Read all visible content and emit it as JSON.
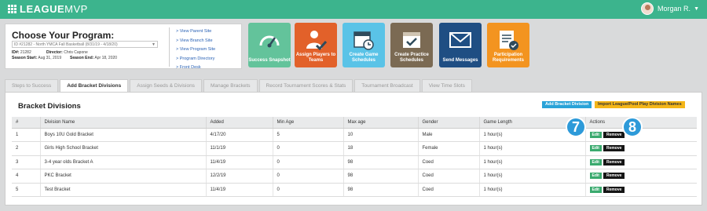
{
  "app": {
    "logo_bold": "LEAGUE",
    "logo_thin": "MVP"
  },
  "user": {
    "name": "Morgan R."
  },
  "program": {
    "heading": "Choose Your Program:",
    "select_value": "ID #21282 - North YMCA Fall Basketball (8/31/19 - 4/18/20)",
    "id_label": "ID#:",
    "id_value": "21282",
    "director_label": "Director:",
    "director_value": "Chris Capone",
    "season_start_label": "Season Start:",
    "season_start_value": "Aug 31, 2019",
    "season_end_label": "Season End:",
    "season_end_value": "Apr 18, 2020",
    "links": [
      "> View Parent Site",
      "> View Branch Site",
      "> View Program Site",
      "> Program Directory",
      "> Front Desk"
    ]
  },
  "tiles": [
    {
      "label": "Success Snapshot",
      "icon": "gauge-icon",
      "color": "#63c39b"
    },
    {
      "label": "Assign Players to Teams",
      "icon": "assign-user-icon",
      "color": "#e2612a"
    },
    {
      "label": "Create Game Schedules",
      "icon": "calendar-clock-icon",
      "color": "#5ac3e7"
    },
    {
      "label": "Create Practice Schedules",
      "icon": "calendar-check-icon",
      "color": "#7b6a53"
    },
    {
      "label": "Send Messages",
      "icon": "envelope-icon",
      "color": "#1f4e83"
    },
    {
      "label": "Participation Requirements",
      "icon": "checklist-icon",
      "color": "#f39420"
    }
  ],
  "tabs": [
    "Steps to Success",
    "Add Bracket Divisions",
    "Assign Seeds & Divisions",
    "Manage Brackets",
    "Record Tournament Scores & Stats",
    "Tournament Broadcast",
    "View Time Slots"
  ],
  "active_tab": "Add Bracket Divisions",
  "section": {
    "title": "Bracket Divisions",
    "add_button": "Add Bracket Division",
    "import_button": "Import League/Pool Play Division Names"
  },
  "table": {
    "columns": [
      "#",
      "Division Name",
      "Added",
      "Min Age",
      "Max age",
      "Gender",
      "Game Length",
      "Actions"
    ],
    "rows": [
      [
        "1",
        "Boys 10U Gold Bracket",
        "4/17/20",
        "5",
        "10",
        "Male",
        "1 hour(s)"
      ],
      [
        "2",
        "Girls High School Bracket",
        "11/1/19",
        "0",
        "18",
        "Female",
        "1 hour(s)"
      ],
      [
        "3",
        "3-4 year olds Bracket A",
        "11/4/19",
        "0",
        "98",
        "Coed",
        "1 hour(s)"
      ],
      [
        "4",
        "PKC Bracket",
        "12/2/19",
        "0",
        "98",
        "Coed",
        "1 hour(s)"
      ],
      [
        "5",
        "Test Bracket",
        "11/4/19",
        "0",
        "98",
        "Coed",
        "1 hour(s)"
      ]
    ],
    "edit_label": "Edit",
    "remove_label": "Remove"
  },
  "callouts": [
    "7",
    "8"
  ]
}
